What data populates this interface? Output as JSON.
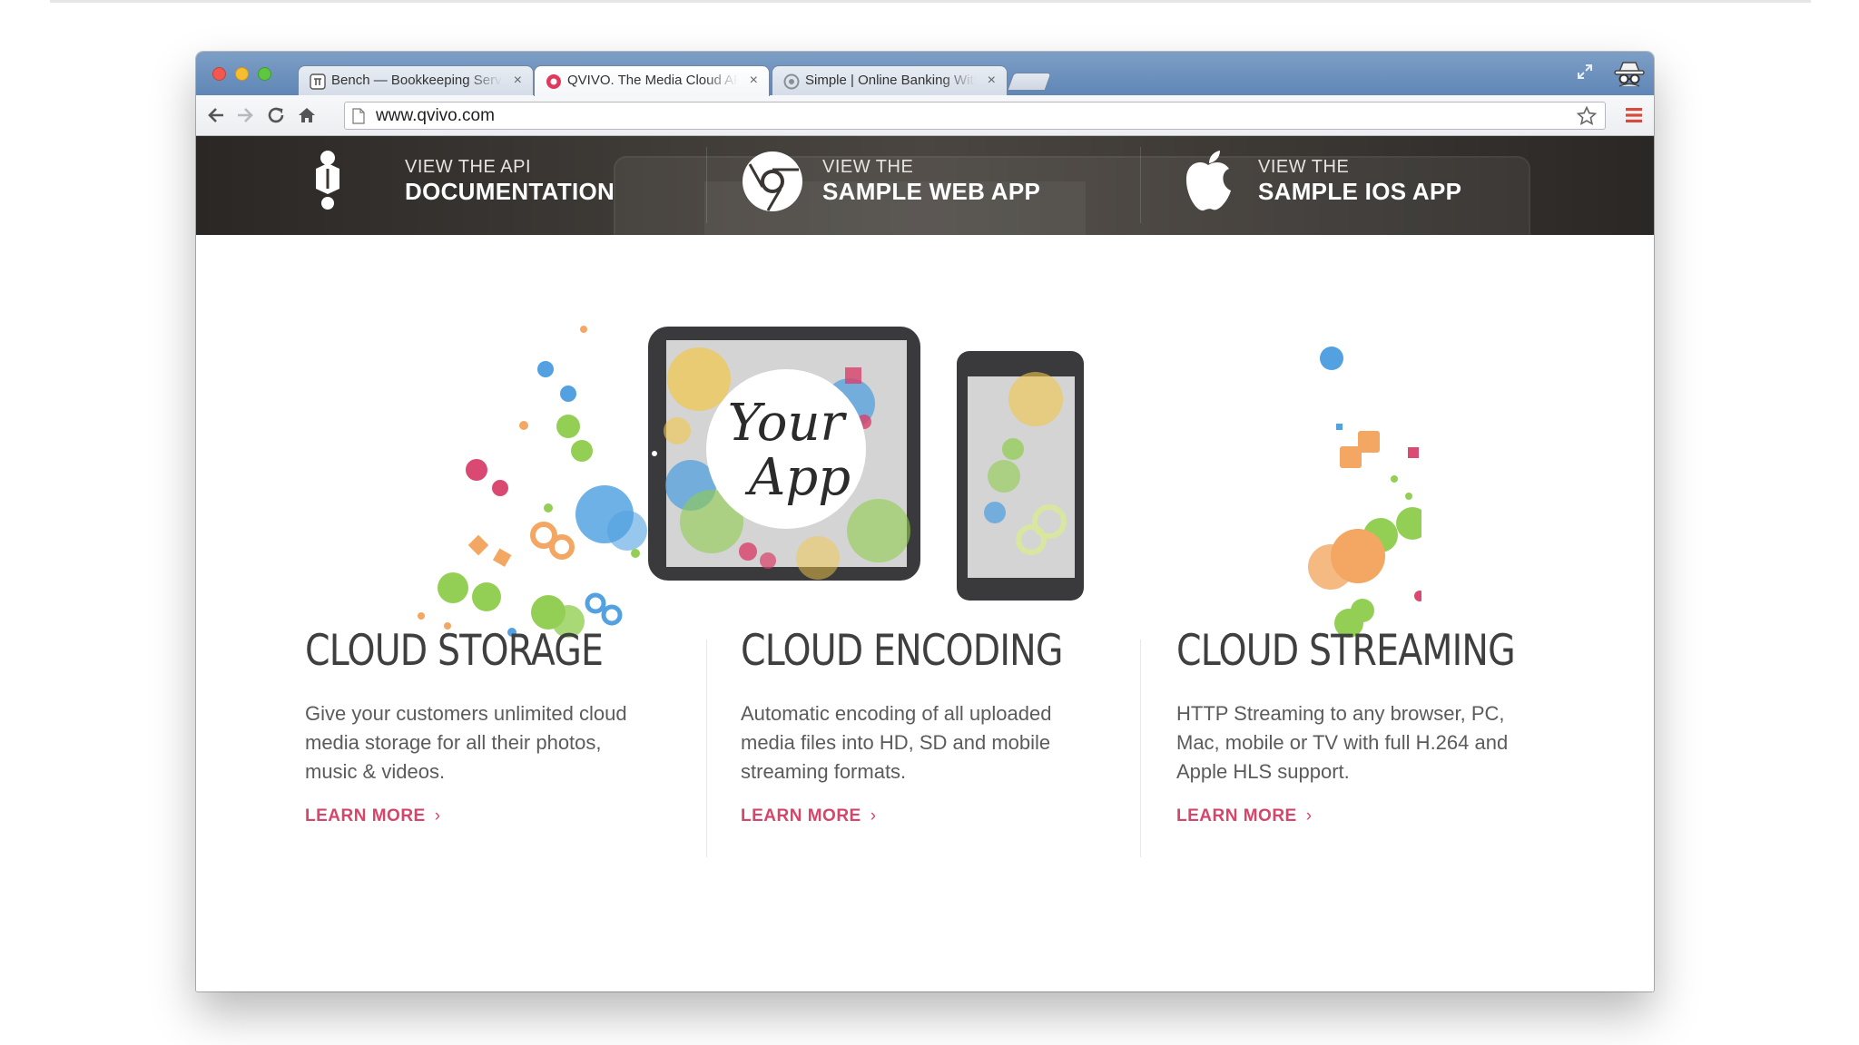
{
  "browser": {
    "tabs": [
      {
        "label": "Bench — Bookkeeping Services",
        "active": false,
        "favicon": "bench-favicon-icon"
      },
      {
        "label": "QVIVO. The Media Cloud API",
        "active": true,
        "favicon": "qvivo-favicon-icon"
      },
      {
        "label": "Simple | Online Banking With",
        "active": false,
        "favicon": "simple-favicon-icon"
      }
    ],
    "tab_close": "×",
    "url": "www.qvivo.com"
  },
  "hero": {
    "items": [
      {
        "line1": "VIEW THE API",
        "line2": "DOCUMENTATION",
        "icon": "api-docs-icon"
      },
      {
        "line1": "VIEW THE",
        "line2": "SAMPLE WEB APP",
        "icon": "chrome-icon"
      },
      {
        "line1": "VIEW THE",
        "line2": "SAMPLE IOS APP",
        "icon": "apple-icon"
      }
    ]
  },
  "illustration": {
    "word1": "Your",
    "word2": "App"
  },
  "features": [
    {
      "title": "CLOUD STORAGE",
      "body": "Give your customers unlimited cloud media storage for all their photos, music & videos.",
      "link": "LEARN MORE"
    },
    {
      "title": "CLOUD ENCODING",
      "body": "Automatic encoding of all uploaded media files into HD, SD and mobile streaming formats.",
      "link": "LEARN MORE"
    },
    {
      "title": "CLOUD STREAMING",
      "body": "HTTP Streaming to any browser, PC, Mac, mobile or TV with full H.264 and Apple HLS support.",
      "link": "LEARN MORE"
    }
  ],
  "link_chevron": "›",
  "colors": {
    "accent": "#d6466b",
    "hero_bg": "#2f2c29",
    "tabstrip": "#6a8fbd"
  }
}
